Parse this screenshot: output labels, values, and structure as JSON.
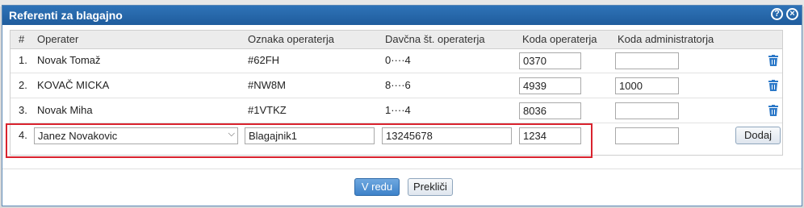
{
  "dialog": {
    "title": "Referenti za blagajno",
    "help_icon": "question-circle-icon",
    "close_icon": "close-circle-icon"
  },
  "table": {
    "headers": [
      "#",
      "Operater",
      "Oznaka operaterja",
      "Davčna št. operaterja",
      "Koda operaterja",
      "Koda administratorja"
    ],
    "rows": [
      {
        "num": "1.",
        "operator": "Novak Tomaž",
        "label": "#62FH",
        "tax": "0····4",
        "code": "0370",
        "admin": ""
      },
      {
        "num": "2.",
        "operator": "KOVAČ MICKA",
        "label": "#NW8M",
        "tax": "8····6",
        "code": "4939",
        "admin": "1000"
      },
      {
        "num": "3.",
        "operator": "Novak Miha",
        "label": "#1VTKZ",
        "tax": "1····4",
        "code": "8036",
        "admin": ""
      }
    ],
    "new_row": {
      "num": "4.",
      "operator": "Janez Novakovic",
      "label": "Blagajnik1",
      "tax": "13245678",
      "code": "1234",
      "admin": "",
      "add_label": "Dodaj"
    }
  },
  "footer": {
    "ok_label": "V redu",
    "cancel_label": "Prekliči"
  },
  "colors": {
    "title_bar": "#2f73b8",
    "highlight": "#d9232e",
    "trash": "#2b78c8"
  }
}
